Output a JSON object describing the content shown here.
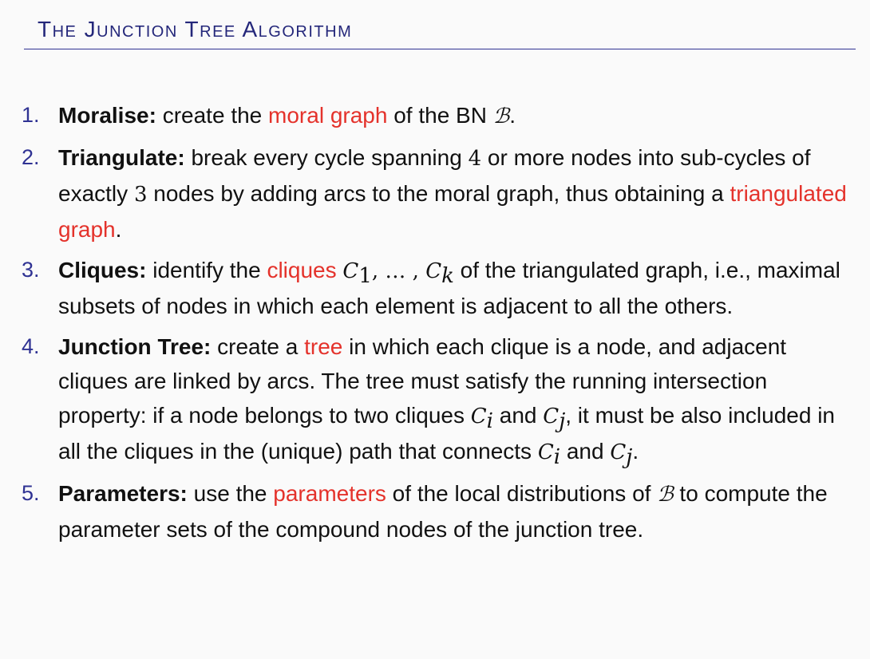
{
  "slide": {
    "title": "The Junction Tree Algorithm"
  },
  "steps": [
    {
      "number": "1.",
      "lead": "Moralise:",
      "t1": " create the ",
      "hl": "moral graph",
      "t2": " of the BN ",
      "symbol": "ℬ",
      "t3": "."
    },
    {
      "number": "2.",
      "lead": "Triangulate:",
      "t1": " break every cycle spanning ",
      "n4": "4",
      "t2": " or more nodes into sub-cycles of exactly ",
      "n3": "3",
      "t3": " nodes by adding arcs to the moral graph, thus obtaining a ",
      "hl": "triangulated graph",
      "t4": "."
    },
    {
      "number": "3.",
      "lead": "Cliques:",
      "t1": " identify the ",
      "hl": "cliques",
      "c": "C",
      "sub1": "1",
      "dots": ", … , ",
      "subk": "k",
      "t2": " of the triangulated graph, i.e., maximal subsets of nodes in which each element is adjacent to all the others."
    },
    {
      "number": "4.",
      "lead": "Junction Tree:",
      "t1": " create a ",
      "hl": "tree",
      "t2": " in which each clique is a node, and adjacent cliques are linked by arcs. The tree must satisfy the running intersection property: if a node belongs to two cliques ",
      "c": "C",
      "sub_i": "i",
      "and": " and ",
      "sub_j": "j",
      "t3": ", it must be also included in all the cliques in the (unique) path that connects ",
      "t4": "."
    },
    {
      "number": "5.",
      "lead": "Parameters:",
      "t1": " use the ",
      "hl": "parameters",
      "t2": " of the local distributions of ",
      "symbol": "ℬ",
      "t3": " to compute the parameter sets of the compound nodes of the junction tree."
    }
  ]
}
